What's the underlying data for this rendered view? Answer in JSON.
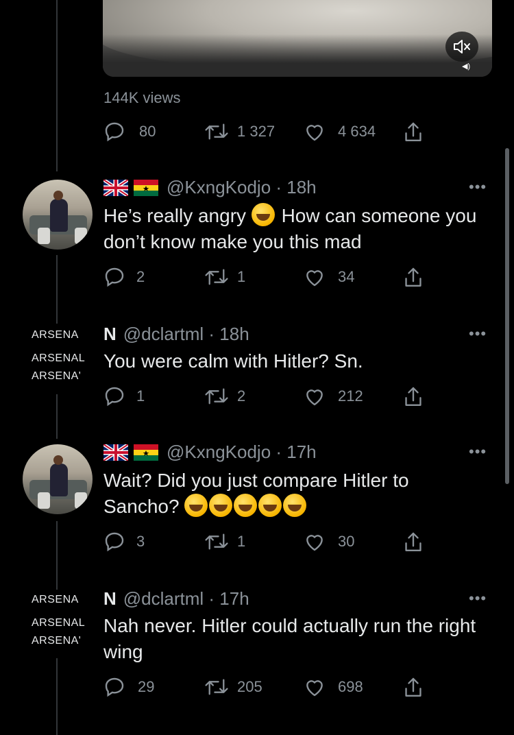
{
  "video": {
    "views_text": "144K views"
  },
  "tweet0_actions": {
    "replies": "80",
    "retweets": "1 327",
    "likes": "4 634"
  },
  "tweets": [
    {
      "handle": "@KxngKodjo · 18h",
      "text_a": "He’s really angry ",
      "text_b": " How can someone you don’t know make you this mad",
      "replies": "2",
      "retweets": "1",
      "likes": "34"
    },
    {
      "name": "N",
      "handle": "@dclartml · 18h",
      "logo": [
        "ARSENA",
        "ARSENAL",
        "ARSENA'"
      ],
      "text": "You were calm with Hitler? Sn.",
      "replies": "1",
      "retweets": "2",
      "likes": "212"
    },
    {
      "handle": "@KxngKodjo · 17h",
      "text": "Wait? Did you just compare Hitler to Sancho? ",
      "replies": "3",
      "retweets": "1",
      "likes": "30"
    },
    {
      "name": "N",
      "handle": "@dclartml · 17h",
      "logo": [
        "ARSENA",
        "ARSENAL",
        "ARSENA'"
      ],
      "text": "Nah never. Hitler could actually run the right wing",
      "replies": "29",
      "retweets": "205",
      "likes": "698"
    }
  ],
  "more_label": "•••",
  "icons": [
    "reply-icon",
    "retweet-icon",
    "like-icon",
    "share-icon",
    "mute-icon",
    "more-icon"
  ],
  "colors": {
    "background": "#000000",
    "text": "#e7e9ea",
    "muted": "#8b9299"
  }
}
